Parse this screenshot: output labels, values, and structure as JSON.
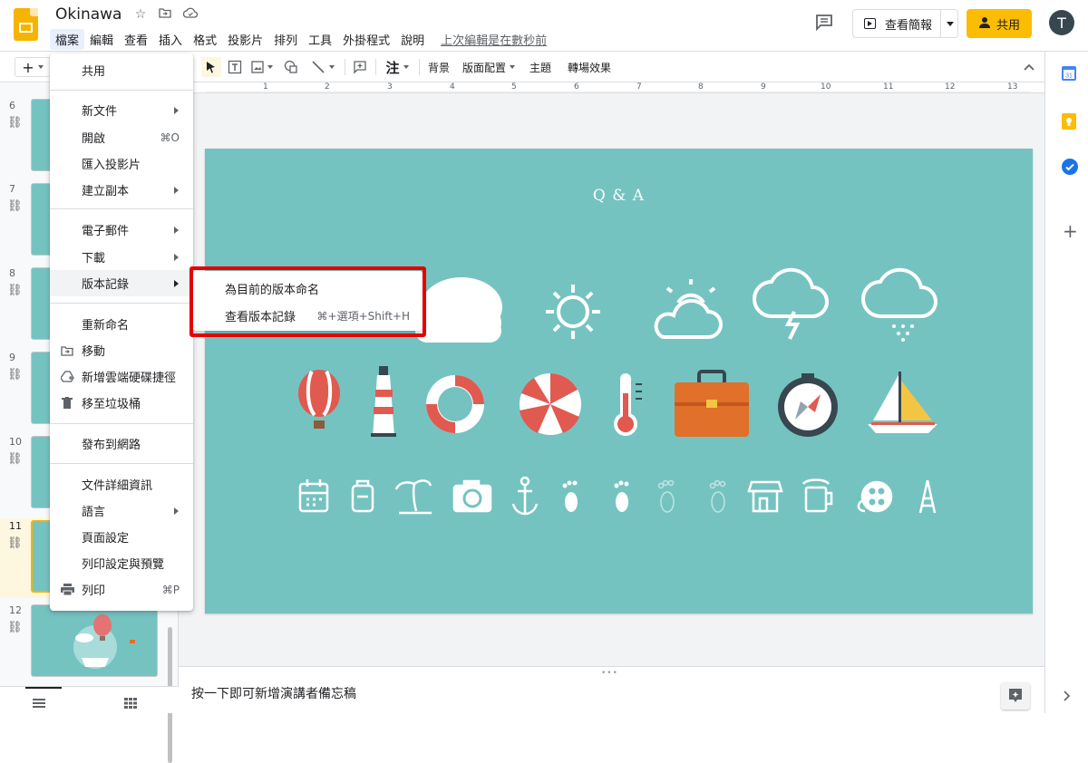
{
  "app": {
    "doc_title": "Okinawa",
    "menus": [
      "檔案",
      "編輯",
      "查看",
      "插入",
      "格式",
      "投影片",
      "排列",
      "工具",
      "外掛程式",
      "說明"
    ],
    "last_edit": "上次編輯是在數秒前",
    "present_label": "查看簡報",
    "share_label": "共用",
    "avatar_letter": "T",
    "brand_color": "#f4b400",
    "share_color": "#fbbc04"
  },
  "toolbar": {
    "add_label": "+",
    "text_style_label": "注",
    "background_label": "背景",
    "layout_label": "版面配置",
    "theme_label": "主題",
    "transition_label": "轉場效果"
  },
  "ruler": {
    "ticks": [
      "1",
      "2",
      "3",
      "4",
      "5",
      "6",
      "7",
      "8",
      "9",
      "10",
      "11",
      "12",
      "13"
    ]
  },
  "filmstrip": {
    "slides": [
      {
        "num": "6"
      },
      {
        "num": "7"
      },
      {
        "num": "8"
      },
      {
        "num": "9"
      },
      {
        "num": "10"
      },
      {
        "num": "11"
      },
      {
        "num": "12"
      }
    ],
    "selected": "11"
  },
  "file_menu": {
    "items": [
      {
        "label": "共用"
      },
      {
        "label": "新文件",
        "submenu": true
      },
      {
        "label": "開啟",
        "shortcut": "⌘O"
      },
      {
        "label": "匯入投影片"
      },
      {
        "label": "建立副本",
        "submenu": true
      },
      {
        "label": "電子郵件",
        "submenu": true
      },
      {
        "label": "下載",
        "submenu": true
      },
      {
        "label": "版本記錄",
        "submenu": true
      },
      {
        "label": "重新命名"
      },
      {
        "label": "移動",
        "icon": "move-folder-icon"
      },
      {
        "label": "新增雲端硬碟捷徑",
        "icon": "drive-shortcut-icon"
      },
      {
        "label": "移至垃圾桶",
        "icon": "trash-icon"
      },
      {
        "label": "發布到網路"
      },
      {
        "label": "文件詳細資訊"
      },
      {
        "label": "語言",
        "submenu": true
      },
      {
        "label": "頁面設定"
      },
      {
        "label": "列印設定與預覽"
      },
      {
        "label": "列印",
        "shortcut": "⌘P",
        "icon": "print-icon"
      }
    ]
  },
  "version_submenu": {
    "items": [
      {
        "label": "為目前的版本命名"
      },
      {
        "label": "查看版本記錄",
        "shortcut": "⌘+選項+Shift+H"
      }
    ],
    "highlight_color": "#e60000"
  },
  "slide": {
    "title": "Q & A",
    "background": "#75c3c1",
    "icon_rows": [
      [
        "cloud-icon",
        "sun-icon",
        "partly-cloudy-icon",
        "thunderstorm-icon",
        "rain-icon"
      ],
      [
        "hot-air-balloon-icon",
        "lighthouse-icon",
        "lifebuoy-icon",
        "beach-umbrella-icon",
        "thermometer-icon",
        "suitcase-icon",
        "compass-icon",
        "sailboat-icon"
      ],
      [
        "calendar-icon",
        "luggage-icon",
        "palm-tree-icon",
        "camera-icon",
        "anchor-icon",
        "footprint-icon",
        "footprint-icon",
        "footprint-icon",
        "footprint-icon",
        "shop-icon",
        "beer-icon",
        "film-reel-icon",
        "eiffel-tower-icon"
      ]
    ]
  },
  "notes": {
    "placeholder": "按一下即可新增演講者備忘稿"
  }
}
